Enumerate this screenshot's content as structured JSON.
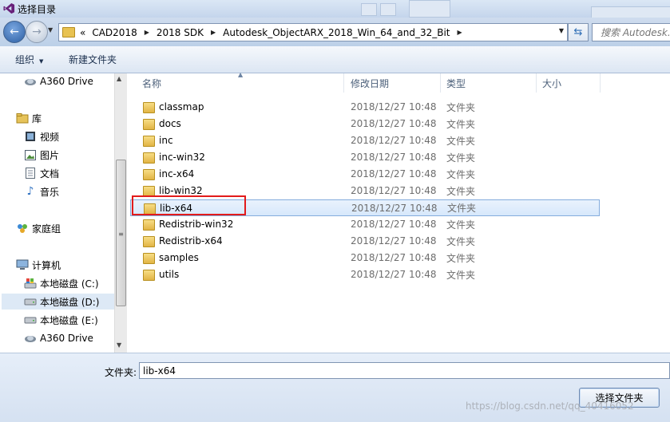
{
  "window": {
    "title": "选择目录"
  },
  "nav": {
    "back_label": "←",
    "forward_label": "→",
    "breadcrumb_prefix": "«",
    "breadcrumbs": [
      "CAD2018",
      "2018 SDK",
      "Autodesk_ObjectARX_2018_Win_64_and_32_Bit"
    ],
    "search_placeholder": "搜索 Autodesk..."
  },
  "toolbar": {
    "organize_label": "组织",
    "new_folder_label": "新建文件夹"
  },
  "sidebar": {
    "items": [
      {
        "label": "A360 Drive",
        "icon": "cloud-icon"
      },
      {
        "label": "库",
        "icon": "library-icon"
      },
      {
        "label": "视频",
        "icon": "video-icon"
      },
      {
        "label": "图片",
        "icon": "picture-icon"
      },
      {
        "label": "文档",
        "icon": "document-icon"
      },
      {
        "label": "音乐",
        "icon": "music-icon"
      },
      {
        "label": "家庭组",
        "icon": "homegroup-icon"
      },
      {
        "label": "计算机",
        "icon": "computer-icon"
      },
      {
        "label": "本地磁盘 (C:)",
        "icon": "drive-icon"
      },
      {
        "label": "本地磁盘 (D:)",
        "icon": "drive-icon",
        "selected": true
      },
      {
        "label": "本地磁盘 (E:)",
        "icon": "drive-icon"
      },
      {
        "label": "A360 Drive",
        "icon": "cloud-icon"
      }
    ]
  },
  "columns": {
    "name": "名称",
    "modified": "修改日期",
    "type": "类型",
    "size": "大小"
  },
  "files": [
    {
      "name": "classmap",
      "date": "2018/12/27 10:48",
      "type": "文件夹"
    },
    {
      "name": "docs",
      "date": "2018/12/27 10:48",
      "type": "文件夹"
    },
    {
      "name": "inc",
      "date": "2018/12/27 10:48",
      "type": "文件夹"
    },
    {
      "name": "inc-win32",
      "date": "2018/12/27 10:48",
      "type": "文件夹"
    },
    {
      "name": "inc-x64",
      "date": "2018/12/27 10:48",
      "type": "文件夹"
    },
    {
      "name": "lib-win32",
      "date": "2018/12/27 10:48",
      "type": "文件夹"
    },
    {
      "name": "lib-x64",
      "date": "2018/12/27 10:48",
      "type": "文件夹",
      "selected": true
    },
    {
      "name": "Redistrib-win32",
      "date": "2018/12/27 10:48",
      "type": "文件夹"
    },
    {
      "name": "Redistrib-x64",
      "date": "2018/12/27 10:48",
      "type": "文件夹"
    },
    {
      "name": "samples",
      "date": "2018/12/27 10:48",
      "type": "文件夹"
    },
    {
      "name": "utils",
      "date": "2018/12/27 10:48",
      "type": "文件夹"
    }
  ],
  "footer": {
    "folder_label": "文件夹:",
    "folder_value": "lib-x64",
    "select_button": "选择文件夹",
    "watermark": "https://blog.csdn.net/qq_40416052"
  },
  "colors": {
    "accent": "#3072c4",
    "selection_border": "#84acdd",
    "highlight_red": "#e21b1b"
  }
}
